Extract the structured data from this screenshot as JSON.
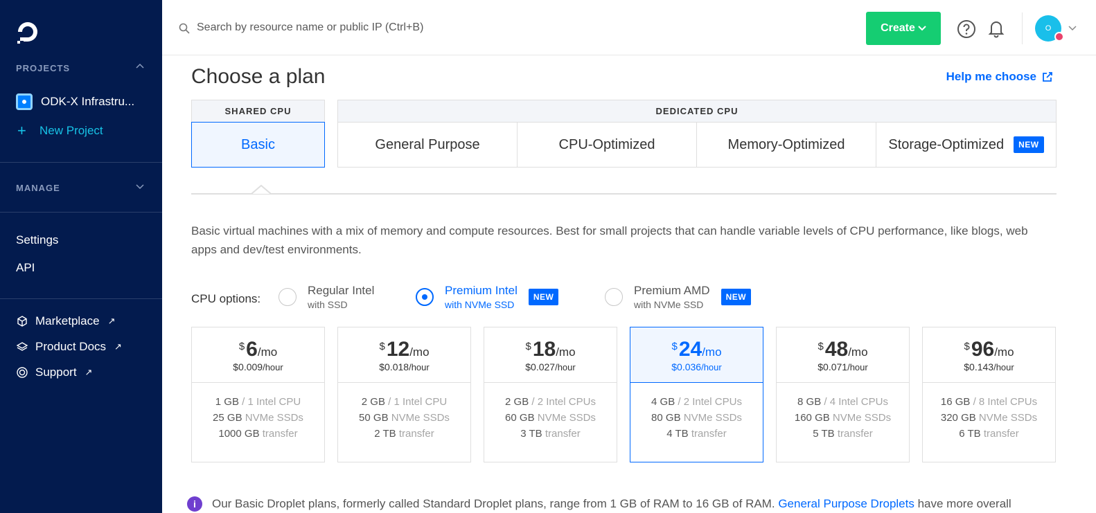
{
  "sidebar": {
    "projects_title": "PROJECTS",
    "project_name": "ODK-X Infrastru...",
    "new_project": "New Project",
    "manage_title": "MANAGE",
    "settings": "Settings",
    "api": "API",
    "links": [
      {
        "label": "Marketplace",
        "icon": "cube-icon"
      },
      {
        "label": "Product Docs",
        "icon": "layers-icon"
      },
      {
        "label": "Support",
        "icon": "lifebuoy-icon"
      }
    ]
  },
  "topbar": {
    "search_placeholder": "Search by resource name or public IP (Ctrl+B)",
    "create_label": "Create",
    "avatar_initial": "O"
  },
  "main": {
    "title": "Choose a plan",
    "help_choose": "Help me choose",
    "shared_header": "SHARED CPU",
    "dedicated_header": "DEDICATED CPU",
    "tabs": [
      "Basic",
      "General Purpose",
      "CPU-Optimized",
      "Memory-Optimized",
      "Storage-Optimized"
    ],
    "new_badge": "NEW",
    "description": "Basic virtual machines with a mix of memory and compute resources. Best for small projects that can handle variable levels of CPU performance, like blogs, web apps and dev/test environments.",
    "cpu_label": "CPU options:",
    "cpu_options": [
      {
        "name": "Regular Intel",
        "sub": "with SSD"
      },
      {
        "name": "Premium Intel",
        "sub": "with NVMe SSD"
      },
      {
        "name": "Premium AMD",
        "sub": "with NVMe SSD"
      }
    ],
    "plans": [
      {
        "dollar": "$",
        "amount": "6",
        "per_month": "/mo",
        "hourly": "$0.009",
        "per_hour": "/hour",
        "mem": "1 GB",
        "cpu": "/ 1 Intel CPU",
        "disk": "25 GB",
        "disk_unit": "NVMe SSDs",
        "transfer": "1000 GB",
        "transfer_unit": "transfer"
      },
      {
        "dollar": "$",
        "amount": "12",
        "per_month": "/mo",
        "hourly": "$0.018",
        "per_hour": "/hour",
        "mem": "2 GB",
        "cpu": "/ 1 Intel CPU",
        "disk": "50 GB",
        "disk_unit": "NVMe SSDs",
        "transfer": "2 TB",
        "transfer_unit": "transfer"
      },
      {
        "dollar": "$",
        "amount": "18",
        "per_month": "/mo",
        "hourly": "$0.027",
        "per_hour": "/hour",
        "mem": "2 GB",
        "cpu": "/ 2 Intel CPUs",
        "disk": "60 GB",
        "disk_unit": "NVMe SSDs",
        "transfer": "3 TB",
        "transfer_unit": "transfer"
      },
      {
        "dollar": "$",
        "amount": "24",
        "per_month": "/mo",
        "hourly": "$0.036",
        "per_hour": "/hour",
        "mem": "4 GB",
        "cpu": "/ 2 Intel CPUs",
        "disk": "80 GB",
        "disk_unit": "NVMe SSDs",
        "transfer": "4 TB",
        "transfer_unit": "transfer"
      },
      {
        "dollar": "$",
        "amount": "48",
        "per_month": "/mo",
        "hourly": "$0.071",
        "per_hour": "/hour",
        "mem": "8 GB",
        "cpu": "/ 4 Intel CPUs",
        "disk": "160 GB",
        "disk_unit": "NVMe SSDs",
        "transfer": "5 TB",
        "transfer_unit": "transfer"
      },
      {
        "dollar": "$",
        "amount": "96",
        "per_month": "/mo",
        "hourly": "$0.143",
        "per_hour": "/hour",
        "mem": "16 GB",
        "cpu": "/ 8 Intel CPUs",
        "disk": "320 GB",
        "disk_unit": "NVMe SSDs",
        "transfer": "6 TB",
        "transfer_unit": "transfer"
      }
    ],
    "info_text": "Our Basic Droplet plans, formerly called Standard Droplet plans, range from 1 GB of RAM to 16 GB of RAM.",
    "info_link": "General Purpose Droplets",
    "info_tail": "have more overall"
  }
}
